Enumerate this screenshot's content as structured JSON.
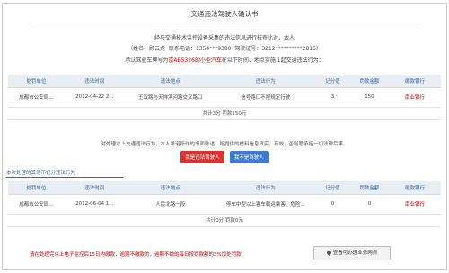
{
  "page": {
    "title": "交通违法驾驶人确认书",
    "declaration": {
      "line1": "经与交通技术监控设备采集的违法信息进行核查比对，本人",
      "line2_prefix": "（姓名：",
      "name": "顾云龙",
      "phone_label": "联系电话：",
      "phone": "1354***9380",
      "license_label": "驾驶证号：",
      "license": "3212**********2815",
      "line2_suffix": "）",
      "line3_prefix": "承认驾驶车牌号为",
      "plate": "京AB5326的小型汽车",
      "line3_suffix": "在以下时间、地点实施 1起交通违法行为："
    }
  },
  "table_columns": [
    "处罚单位",
    "违法时间",
    "违法地点",
    "违法行为",
    "记分值",
    "罚款金额",
    "缴款银行"
  ],
  "table1": {
    "rows": [
      {
        "unit": "成都市公安局...",
        "time": "2012-04-22 2...",
        "location": "王双路与天祥滨河路交叉路口",
        "behavior": "信号路口不按规定行驶",
        "points": "3",
        "fine": "150",
        "bank": "南业银行"
      }
    ],
    "summary": "共计3分  罚款150元"
  },
  "notice": "对处理以上交通违法行为，本人承诺所作的书面陈述、所提供的材料信息真实、有效，否则愿承担一切法律后果。",
  "buttons": {
    "confirm": "我是违法驾驶人",
    "deny": "我不是驾驶人"
  },
  "section2": {
    "label": "本次处理的其他不记分违法行为"
  },
  "table2": {
    "rows": [
      {
        "unit": "成都市公安局...",
        "time": "2012-06-04 1...",
        "location": "人民北路一段",
        "behavior": "停车中型以上客车载运乘客、危险...",
        "points": "0",
        "fine": "0",
        "bank": "南业银行"
      }
    ],
    "summary": "共计0分  罚款0元"
  },
  "bottom_notice": "请在处理完以上电子监控后15日内缴款，逾期不缴款的，逾期不缴的每日按罚款额的3%加处罚款",
  "outlet_button": "查看可办理业务网点"
}
